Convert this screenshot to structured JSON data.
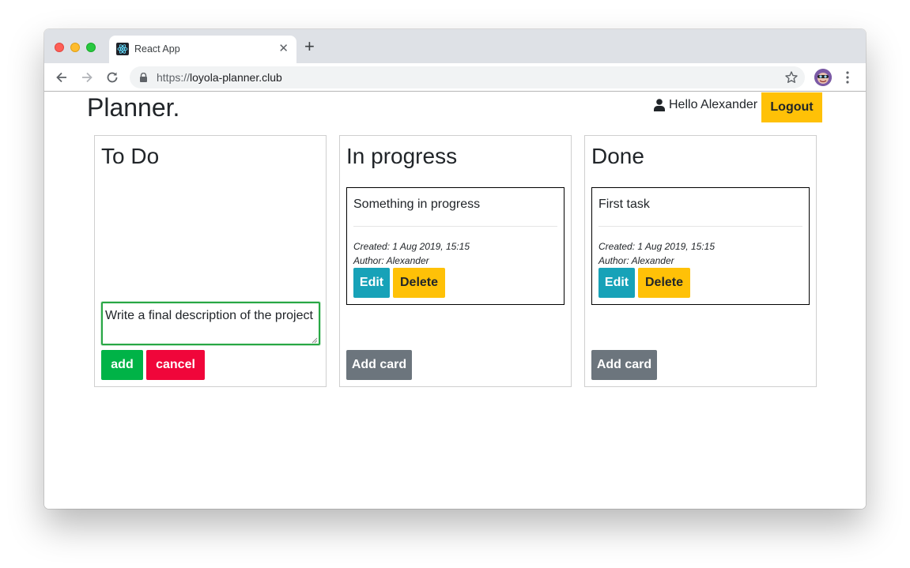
{
  "browser": {
    "tab_title": "React App",
    "url_scheme": "https://",
    "url_host": "loyola-planner.club"
  },
  "header": {
    "brand": "Planner.",
    "greeting": "Hello Alexander",
    "logout_label": "Logout"
  },
  "columns": [
    {
      "title": "To Do",
      "draft": {
        "value": "Write a final description of the project",
        "add_label": "add",
        "cancel_label": "cancel"
      }
    },
    {
      "title": "In progress",
      "card": {
        "title": "Something in progress",
        "created": "Created: 1 Aug 2019, 15:15",
        "author": "Author: Alexander",
        "edit_label": "Edit",
        "delete_label": "Delete"
      },
      "add_card_label": "Add card"
    },
    {
      "title": "Done",
      "card": {
        "title": "First task",
        "created": "Created: 1 Aug 2019, 15:15",
        "author": "Author: Alexander",
        "edit_label": "Edit",
        "delete_label": "Delete"
      },
      "add_card_label": "Add card"
    }
  ],
  "colors": {
    "edit": "#17a2b8",
    "warning": "#ffc107",
    "add": "#00b347",
    "cancel": "#f0063a",
    "secondary": "#6c757d",
    "focus_border": "#28a745"
  },
  "icons": [
    "react-favicon-icon",
    "close-icon",
    "plus-icon",
    "back-arrow-icon",
    "forward-arrow-icon",
    "reload-icon",
    "lock-icon",
    "star-icon",
    "user-icon",
    "kebab-menu-icon"
  ]
}
